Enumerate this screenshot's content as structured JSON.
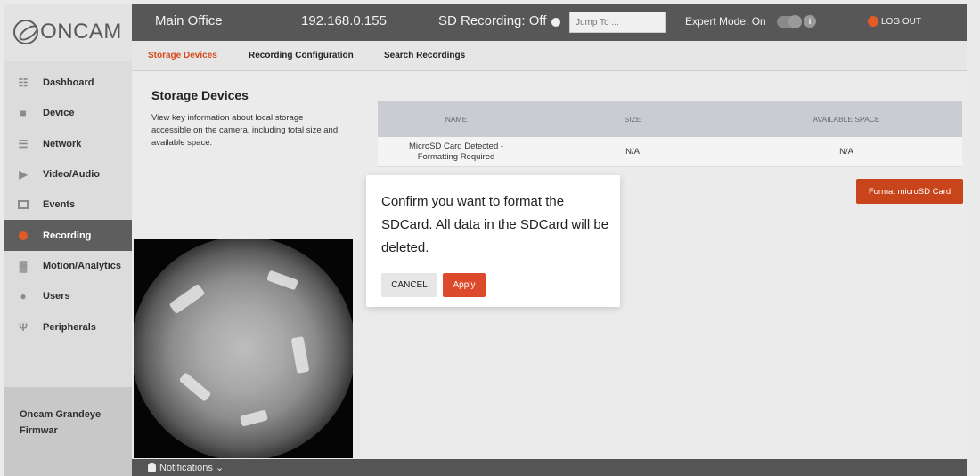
{
  "brand": {
    "logo_text": "ONCAM"
  },
  "header": {
    "site_name": "Main Office",
    "ip_address": "192.168.0.155",
    "sd_status": "SD Recording: Off",
    "jump_placeholder": "Jump To ...",
    "expert_mode": "Expert Mode: On",
    "logout": "LOG OUT",
    "accent": "#e25a25"
  },
  "tabs": [
    {
      "label": "Storage Devices",
      "active": true
    },
    {
      "label": "Recording Configuration",
      "active": false
    },
    {
      "label": "Search Recordings",
      "active": false
    }
  ],
  "sidebar": {
    "items": [
      {
        "label": "Dashboard",
        "icon": "grid-icon"
      },
      {
        "label": "Device",
        "icon": "camera-icon"
      },
      {
        "label": "Network",
        "icon": "server-icon"
      },
      {
        "label": "Video/Audio",
        "icon": "play-icon"
      },
      {
        "label": "Events",
        "icon": "calendar-icon"
      },
      {
        "label": "Recording",
        "icon": "record-dot-icon",
        "active": true
      },
      {
        "label": "Motion/Analytics",
        "icon": "bar-chart-icon"
      },
      {
        "label": "Users",
        "icon": "user-icon"
      },
      {
        "label": "Peripherals",
        "icon": "usb-icon"
      }
    ],
    "firmware_line1": "Oncam Grandeye",
    "firmware_line2": "Firmwar"
  },
  "storage": {
    "title": "Storage Devices",
    "description": "View key information about local storage accessible on the camera, including total size and available space.",
    "columns": [
      "NAME",
      "SIZE",
      "AVAILABLE SPACE"
    ],
    "rows": [
      {
        "name_line1": "MicroSD Card Detected -",
        "name_line2": "Formatting Required",
        "size": "N/A",
        "available": "N/A"
      }
    ],
    "format_button": "Format microSD Card"
  },
  "modal": {
    "message": "Confirm you want to format the SDCard. All data in the SDCard will be deleted.",
    "cancel": "CANCEL",
    "apply": "Apply"
  },
  "footer": {
    "notifications": "Notifications ⌄"
  }
}
